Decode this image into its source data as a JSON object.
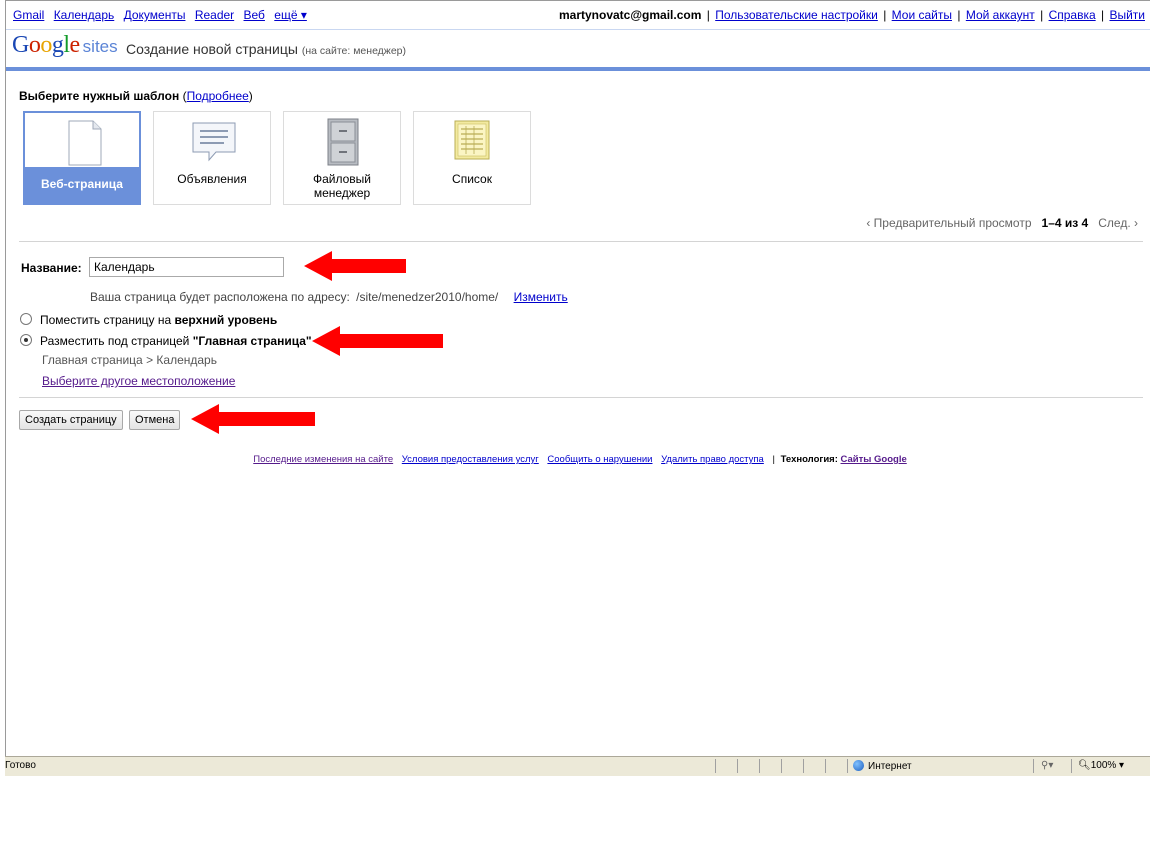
{
  "topbar": {
    "links": [
      "Gmail",
      "Календарь",
      "Документы",
      "Reader",
      "Веб",
      "ещё ▾"
    ],
    "email": "martynovatc@gmail.com",
    "right_links": [
      "Пользовательские настройки",
      "Мои сайты",
      "Мой аккаунт",
      "Справка",
      "Выйти"
    ]
  },
  "header": {
    "logo_sites": "sites",
    "title": "Создание новой страницы",
    "subtitle": "(на сайте: менеджер)"
  },
  "templates": {
    "heading": "Выберите нужный шаблон",
    "more": "Подробнее",
    "items": [
      {
        "label": "Веб-страница",
        "icon": "page-icon",
        "selected": true
      },
      {
        "label": "Объявления",
        "icon": "announcement-icon",
        "selected": false
      },
      {
        "label_line1": "Файловый",
        "label_line2": "менеджер",
        "icon": "file-cabinet-icon",
        "selected": false
      },
      {
        "label": "Список",
        "icon": "list-icon",
        "selected": false
      }
    ],
    "pager_prev": "‹ Предварительный просмотр",
    "pager_range": "1–4 из 4",
    "pager_next": "След. ›"
  },
  "form": {
    "name_label": "Название:",
    "name_value": "Календарь",
    "url_text": "Ваша страница будет расположена по адресу:",
    "url_path": "/site/menedzer2010/home/",
    "url_change": "Изменить",
    "option_top_pre": "Поместить страницу на ",
    "option_top_bold": "верхний уровень",
    "option_under_pre": "Разместить под страницей ",
    "option_under_bold": "\"Главная страница\"",
    "option_selected": "under",
    "breadcrumb": "Главная страница > Календарь",
    "other_location": "Выберите другое местоположение",
    "create_button": "Создать страницу",
    "cancel_button": "Отмена"
  },
  "footer": {
    "links": [
      "Последние изменения на сайте",
      "Условия предоставления услуг",
      "Сообщить о нарушении",
      "Удалить право доступа"
    ],
    "tech_label": "Технология:",
    "tech_link": "Сайты Google"
  },
  "statusbar": {
    "ready": "Готово",
    "zone": "Интернет",
    "zoom": "100%"
  },
  "colors": {
    "accent": "#6b90da",
    "link": "#0000cc",
    "visited": "#551a8b",
    "arrow": "#ff0000"
  }
}
